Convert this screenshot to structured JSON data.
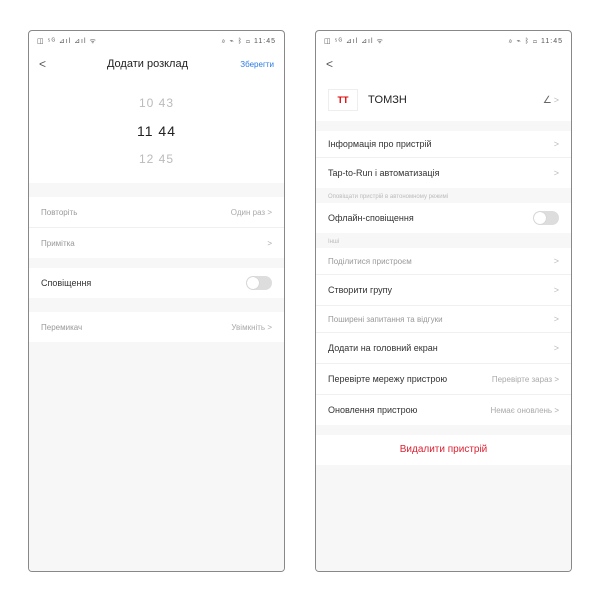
{
  "status": {
    "left": "◫ ⁵ᴳ ⊿ıl ⊿ıl ᯤ",
    "right": "⌀ ⌁ ᛒ ▭ 11:45"
  },
  "left": {
    "title": "Додати розклад",
    "save": "Зберегти",
    "picker": {
      "prev": "10 43",
      "sel": "11 44",
      "next": "12 45"
    },
    "repeat": {
      "label": "Повторіть",
      "value": "Один раз >"
    },
    "note": {
      "label": "Примітка",
      "value": ">"
    },
    "notify": {
      "label": "Сповіщення"
    },
    "switch": {
      "label": "Перемикач",
      "value": "Увімкніть >"
    }
  },
  "right": {
    "device": {
      "logo": "TT",
      "name": "TOMЗН"
    },
    "info": {
      "label": "Інформація про пристрій"
    },
    "tap": {
      "label": "Tap-to-Run і автоматизація"
    },
    "note1": "Оповіщати пристрій в автономному режимі",
    "offline": {
      "label": "Офлайн-сповіщення"
    },
    "note2": "Інші",
    "share": {
      "label": "Поділитися пристроєм"
    },
    "group": {
      "label": "Створити групу"
    },
    "faq": {
      "label": "Поширені запитання та відгуки"
    },
    "home": {
      "label": "Додати на головний екран"
    },
    "net": {
      "label": "Перевірте мережу пристрою",
      "value": "Перевірте зараз >"
    },
    "upd": {
      "label": "Оновлення пристрою",
      "value": "Немає оновлень >"
    },
    "delete": "Видалити пристрій"
  }
}
